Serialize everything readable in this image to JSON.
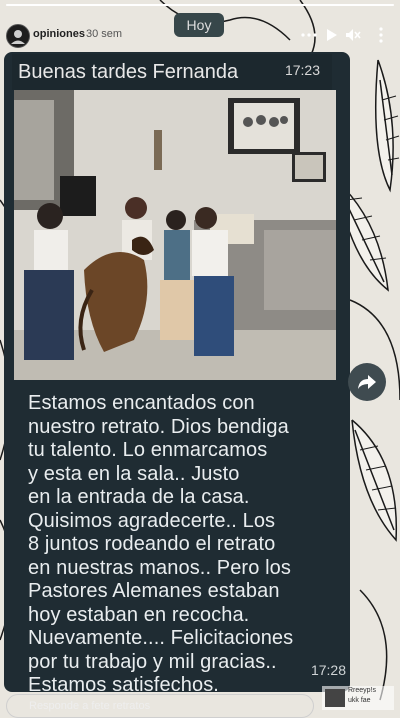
{
  "story": {
    "username": "opiniones",
    "time_ago": "30 sem",
    "progress_fraction": 1.0
  },
  "chat": {
    "date_chip": "Hoy",
    "greeting": "Buenas tardes Fernanda",
    "greeting_time": "17:23",
    "message_lines": [
      "Estamos encantados con",
      "nuestro retrato. Dios bendiga",
      "tu talento. Lo enmarcamos",
      "y esta en la sala.. Justo",
      "en la entrada de la casa.",
      "Quisimos agradecerte.. Los",
      "8 juntos rodeando el retrato",
      "en nuestras manos.. Pero los",
      "Pastores Alemanes estaban",
      "hoy estaban en recocha.",
      "Nuevamente.... Felicitaciones",
      "por tu trabajo y mil gracias..",
      "Estamos satisfechos."
    ],
    "message_time": "17:28"
  },
  "reply": {
    "placeholder": "Responde a fete retratos"
  },
  "watermark": {
    "line1": "Rreeyp!s",
    "line2": "ukk fae"
  },
  "icons": [
    "more-icon",
    "play-icon",
    "mute-icon",
    "share-icon"
  ],
  "colors": {
    "bubble": "#1f2c33",
    "text": "#e9edef"
  }
}
